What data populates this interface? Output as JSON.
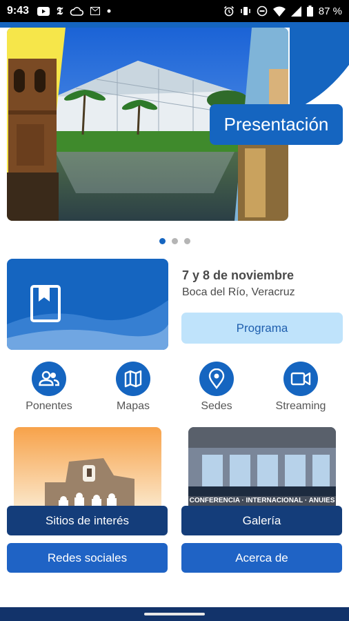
{
  "status_bar": {
    "time": "9:43",
    "battery": "87 %",
    "left_icons": [
      "youtube-icon",
      "nyt-icon",
      "cloud-icon",
      "gmail-icon",
      "dot-icon"
    ],
    "right_icons": [
      "alarm-icon",
      "vibrate-icon",
      "dnd-icon",
      "wifi-icon",
      "signal-icon",
      "battery-icon"
    ]
  },
  "carousel": {
    "caption": "Presentación",
    "pages": 3,
    "active_page": 1
  },
  "event": {
    "date": "7 y 8 de noviembre",
    "place": "Boca del Río, Veracruz",
    "program_label": "Programa",
    "card_icon": "book-bookmark-icon"
  },
  "quick_links": [
    {
      "label": "Ponentes",
      "icon": "people-icon"
    },
    {
      "label": "Mapas",
      "icon": "map-icon"
    },
    {
      "label": "Sedes",
      "icon": "location-pin-icon"
    },
    {
      "label": "Streaming",
      "icon": "video-camera-icon"
    }
  ],
  "tiles": {
    "sitios": "Sitios de interés",
    "galeria": "Galería",
    "redes": "Redes sociales",
    "acerca": "Acerca de",
    "banner_text": "CONFERENCIA · INTERNACIONAL · ANUIES"
  },
  "colors": {
    "primary": "#1565c0",
    "dark_button": "#143d7a",
    "light_button": "#bfe3fb",
    "nav_bar": "#12336a"
  }
}
